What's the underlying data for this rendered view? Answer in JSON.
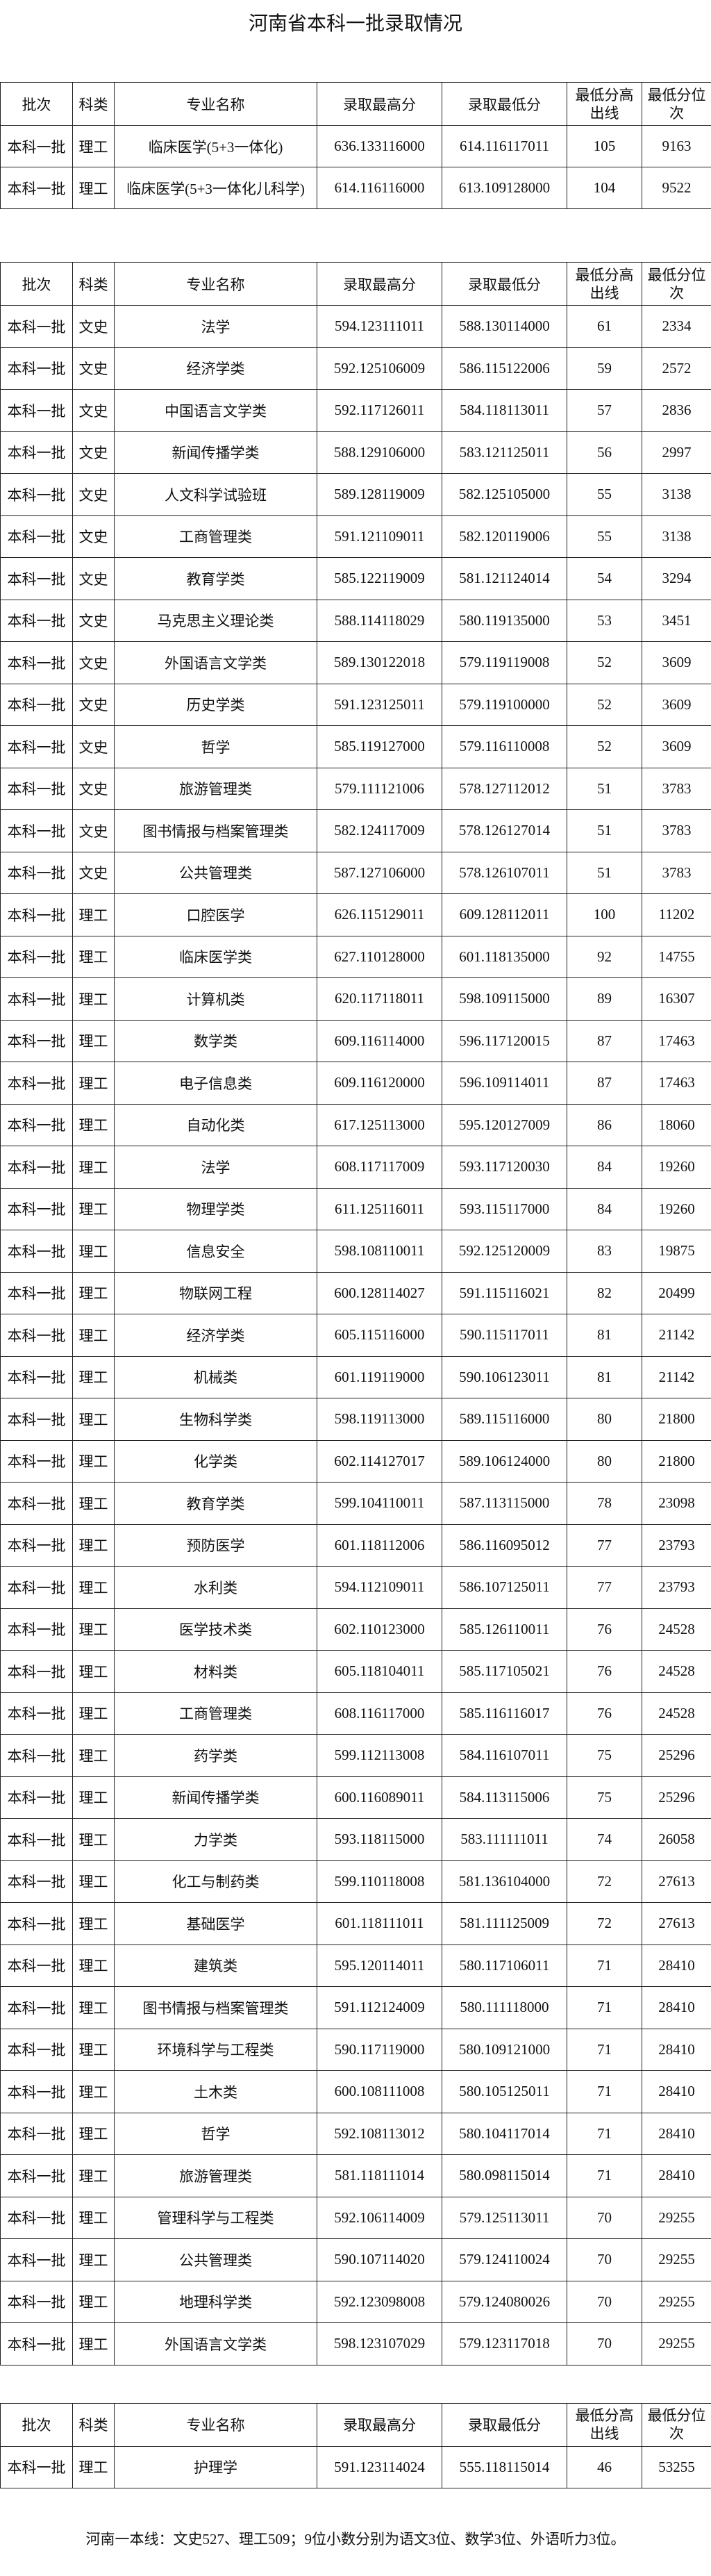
{
  "page_title": "河南省本科一批录取情况",
  "headers": [
    "批次",
    "科类",
    "专业名称",
    "录取最高分",
    "录取最低分",
    "最低分高出线",
    "最低分位次"
  ],
  "tables": [
    {
      "rows": [
        [
          "本科一批",
          "理工",
          "临床医学(5+3一体化)",
          "636.133116000",
          "614.116117011",
          "105",
          "9163"
        ],
        [
          "本科一批",
          "理工",
          "临床医学(5+3一体化儿科学)",
          "614.116116000",
          "613.109128000",
          "104",
          "9522"
        ]
      ]
    },
    {
      "rows": [
        [
          "本科一批",
          "文史",
          "法学",
          "594.123111011",
          "588.130114000",
          "61",
          "2334"
        ],
        [
          "本科一批",
          "文史",
          "经济学类",
          "592.125106009",
          "586.115122006",
          "59",
          "2572"
        ],
        [
          "本科一批",
          "文史",
          "中国语言文学类",
          "592.117126011",
          "584.118113011",
          "57",
          "2836"
        ],
        [
          "本科一批",
          "文史",
          "新闻传播学类",
          "588.129106000",
          "583.121125011",
          "56",
          "2997"
        ],
        [
          "本科一批",
          "文史",
          "人文科学试验班",
          "589.128119009",
          "582.125105000",
          "55",
          "3138"
        ],
        [
          "本科一批",
          "文史",
          "工商管理类",
          "591.121109011",
          "582.120119006",
          "55",
          "3138"
        ],
        [
          "本科一批",
          "文史",
          "教育学类",
          "585.122119009",
          "581.121124014",
          "54",
          "3294"
        ],
        [
          "本科一批",
          "文史",
          "马克思主义理论类",
          "588.114118029",
          "580.119135000",
          "53",
          "3451"
        ],
        [
          "本科一批",
          "文史",
          "外国语言文学类",
          "589.130122018",
          "579.119119008",
          "52",
          "3609"
        ],
        [
          "本科一批",
          "文史",
          "历史学类",
          "591.123125011",
          "579.119100000",
          "52",
          "3609"
        ],
        [
          "本科一批",
          "文史",
          "哲学",
          "585.119127000",
          "579.116110008",
          "52",
          "3609"
        ],
        [
          "本科一批",
          "文史",
          "旅游管理类",
          "579.111121006",
          "578.127112012",
          "51",
          "3783"
        ],
        [
          "本科一批",
          "文史",
          "图书情报与档案管理类",
          "582.124117009",
          "578.126127014",
          "51",
          "3783"
        ],
        [
          "本科一批",
          "文史",
          "公共管理类",
          "587.127106000",
          "578.126107011",
          "51",
          "3783"
        ],
        [
          "本科一批",
          "理工",
          "口腔医学",
          "626.115129011",
          "609.128112011",
          "100",
          "11202"
        ],
        [
          "本科一批",
          "理工",
          "临床医学类",
          "627.110128000",
          "601.118135000",
          "92",
          "14755"
        ],
        [
          "本科一批",
          "理工",
          "计算机类",
          "620.117118011",
          "598.109115000",
          "89",
          "16307"
        ],
        [
          "本科一批",
          "理工",
          "数学类",
          "609.116114000",
          "596.117120015",
          "87",
          "17463"
        ],
        [
          "本科一批",
          "理工",
          "电子信息类",
          "609.116120000",
          "596.109114011",
          "87",
          "17463"
        ],
        [
          "本科一批",
          "理工",
          "自动化类",
          "617.125113000",
          "595.120127009",
          "86",
          "18060"
        ],
        [
          "本科一批",
          "理工",
          "法学",
          "608.117117009",
          "593.117120030",
          "84",
          "19260"
        ],
        [
          "本科一批",
          "理工",
          "物理学类",
          "611.125116011",
          "593.115117000",
          "84",
          "19260"
        ],
        [
          "本科一批",
          "理工",
          "信息安全",
          "598.108110011",
          "592.125120009",
          "83",
          "19875"
        ],
        [
          "本科一批",
          "理工",
          "物联网工程",
          "600.128114027",
          "591.115116021",
          "82",
          "20499"
        ],
        [
          "本科一批",
          "理工",
          "经济学类",
          "605.115116000",
          "590.115117011",
          "81",
          "21142"
        ],
        [
          "本科一批",
          "理工",
          "机械类",
          "601.119119000",
          "590.106123011",
          "81",
          "21142"
        ],
        [
          "本科一批",
          "理工",
          "生物科学类",
          "598.119113000",
          "589.115116000",
          "80",
          "21800"
        ],
        [
          "本科一批",
          "理工",
          "化学类",
          "602.114127017",
          "589.106124000",
          "80",
          "21800"
        ],
        [
          "本科一批",
          "理工",
          "教育学类",
          "599.104110011",
          "587.113115000",
          "78",
          "23098"
        ],
        [
          "本科一批",
          "理工",
          "预防医学",
          "601.118112006",
          "586.116095012",
          "77",
          "23793"
        ],
        [
          "本科一批",
          "理工",
          "水利类",
          "594.112109011",
          "586.107125011",
          "77",
          "23793"
        ],
        [
          "本科一批",
          "理工",
          "医学技术类",
          "602.110123000",
          "585.126110011",
          "76",
          "24528"
        ],
        [
          "本科一批",
          "理工",
          "材料类",
          "605.118104011",
          "585.117105021",
          "76",
          "24528"
        ],
        [
          "本科一批",
          "理工",
          "工商管理类",
          "608.116117000",
          "585.116116017",
          "76",
          "24528"
        ],
        [
          "本科一批",
          "理工",
          "药学类",
          "599.112113008",
          "584.116107011",
          "75",
          "25296"
        ],
        [
          "本科一批",
          "理工",
          "新闻传播学类",
          "600.116089011",
          "584.113115006",
          "75",
          "25296"
        ],
        [
          "本科一批",
          "理工",
          "力学类",
          "593.118115000",
          "583.111111011",
          "74",
          "26058"
        ],
        [
          "本科一批",
          "理工",
          "化工与制药类",
          "599.110118008",
          "581.136104000",
          "72",
          "27613"
        ],
        [
          "本科一批",
          "理工",
          "基础医学",
          "601.118111011",
          "581.111125009",
          "72",
          "27613"
        ],
        [
          "本科一批",
          "理工",
          "建筑类",
          "595.120114011",
          "580.117106011",
          "71",
          "28410"
        ],
        [
          "本科一批",
          "理工",
          "图书情报与档案管理类",
          "591.112124009",
          "580.111118000",
          "71",
          "28410"
        ],
        [
          "本科一批",
          "理工",
          "环境科学与工程类",
          "590.117119000",
          "580.109121000",
          "71",
          "28410"
        ],
        [
          "本科一批",
          "理工",
          "土木类",
          "600.108111008",
          "580.105125011",
          "71",
          "28410"
        ],
        [
          "本科一批",
          "理工",
          "哲学",
          "592.108113012",
          "580.104117014",
          "71",
          "28410"
        ],
        [
          "本科一批",
          "理工",
          "旅游管理类",
          "581.118111014",
          "580.098115014",
          "71",
          "28410"
        ],
        [
          "本科一批",
          "理工",
          "管理科学与工程类",
          "592.106114009",
          "579.125113011",
          "70",
          "29255"
        ],
        [
          "本科一批",
          "理工",
          "公共管理类",
          "590.107114020",
          "579.124110024",
          "70",
          "29255"
        ],
        [
          "本科一批",
          "理工",
          "地理科学类",
          "592.123098008",
          "579.124080026",
          "70",
          "29255"
        ],
        [
          "本科一批",
          "理工",
          "外国语言文学类",
          "598.123107029",
          "579.123117018",
          "70",
          "29255"
        ]
      ]
    },
    {
      "rows": [
        [
          "本科一批",
          "理工",
          "护理学",
          "591.123114024",
          "555.118115014",
          "46",
          "53255"
        ]
      ]
    }
  ],
  "footer": "河南一本线：文史527、理工509；9位小数分别为语文3位、数学3位、外语听力3位。"
}
